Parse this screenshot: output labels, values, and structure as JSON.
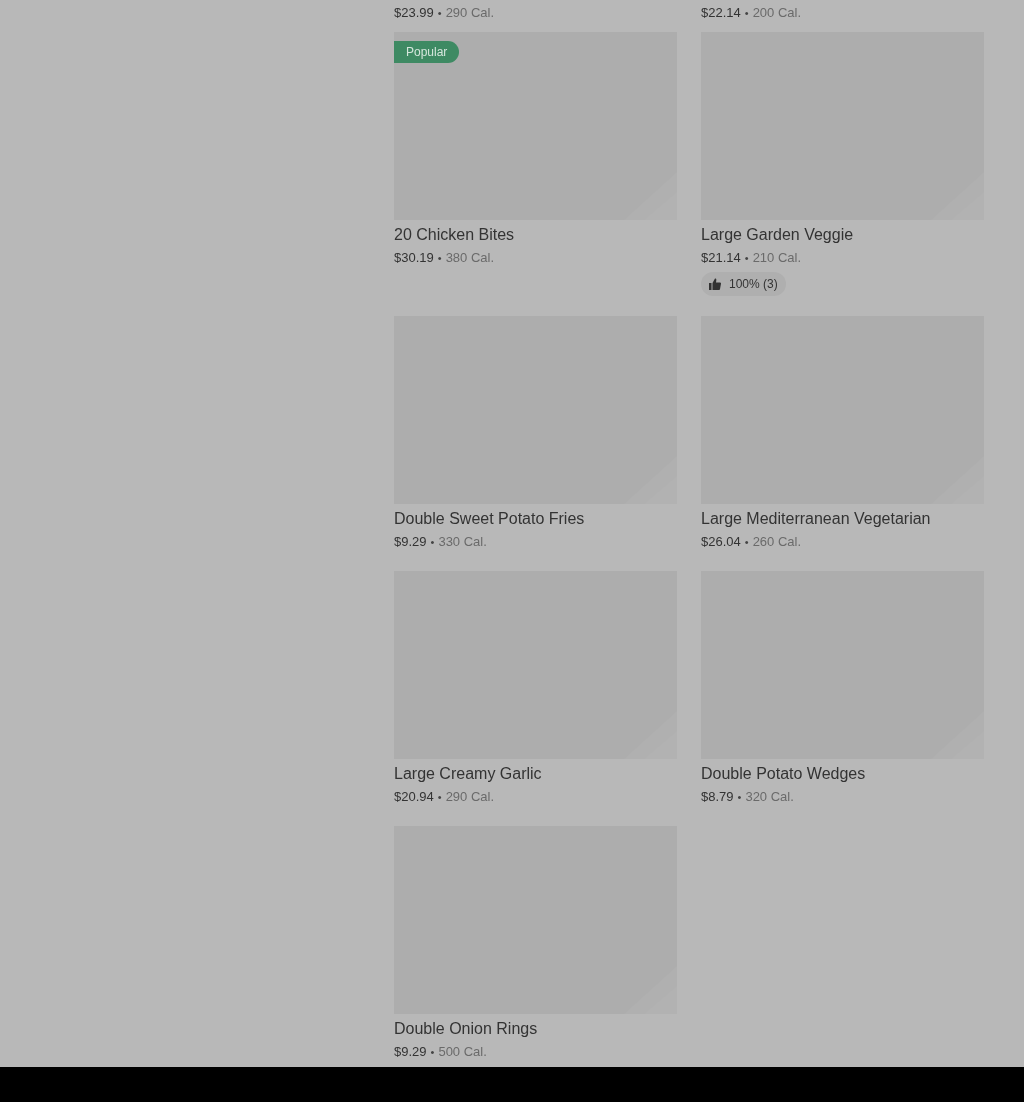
{
  "partial_row": [
    {
      "price": "$23.99",
      "separator": "•",
      "calories": "290 Cal."
    },
    {
      "price": "$22.14",
      "separator": "•",
      "calories": "200 Cal."
    }
  ],
  "items": [
    {
      "name": "20 Chicken Bites",
      "price": "$30.19",
      "separator": "•",
      "calories": "380 Cal.",
      "badge": "Popular"
    },
    {
      "name": "Large Garden Veggie",
      "price": "$21.14",
      "separator": "•",
      "calories": "210 Cal.",
      "rating": "100% (3)"
    },
    {
      "name": "Double Sweet Potato Fries",
      "price": "$9.29",
      "separator": "•",
      "calories": "330 Cal."
    },
    {
      "name": "Large Mediterranean Vegetarian",
      "price": "$26.04",
      "separator": "•",
      "calories": "260 Cal."
    },
    {
      "name": "Large Creamy Garlic",
      "price": "$20.94",
      "separator": "•",
      "calories": "290 Cal."
    },
    {
      "name": "Double Potato Wedges",
      "price": "$8.79",
      "separator": "•",
      "calories": "320 Cal."
    },
    {
      "name": "Double Onion Rings",
      "price": "$9.29",
      "separator": "•",
      "calories": "500 Cal."
    }
  ]
}
